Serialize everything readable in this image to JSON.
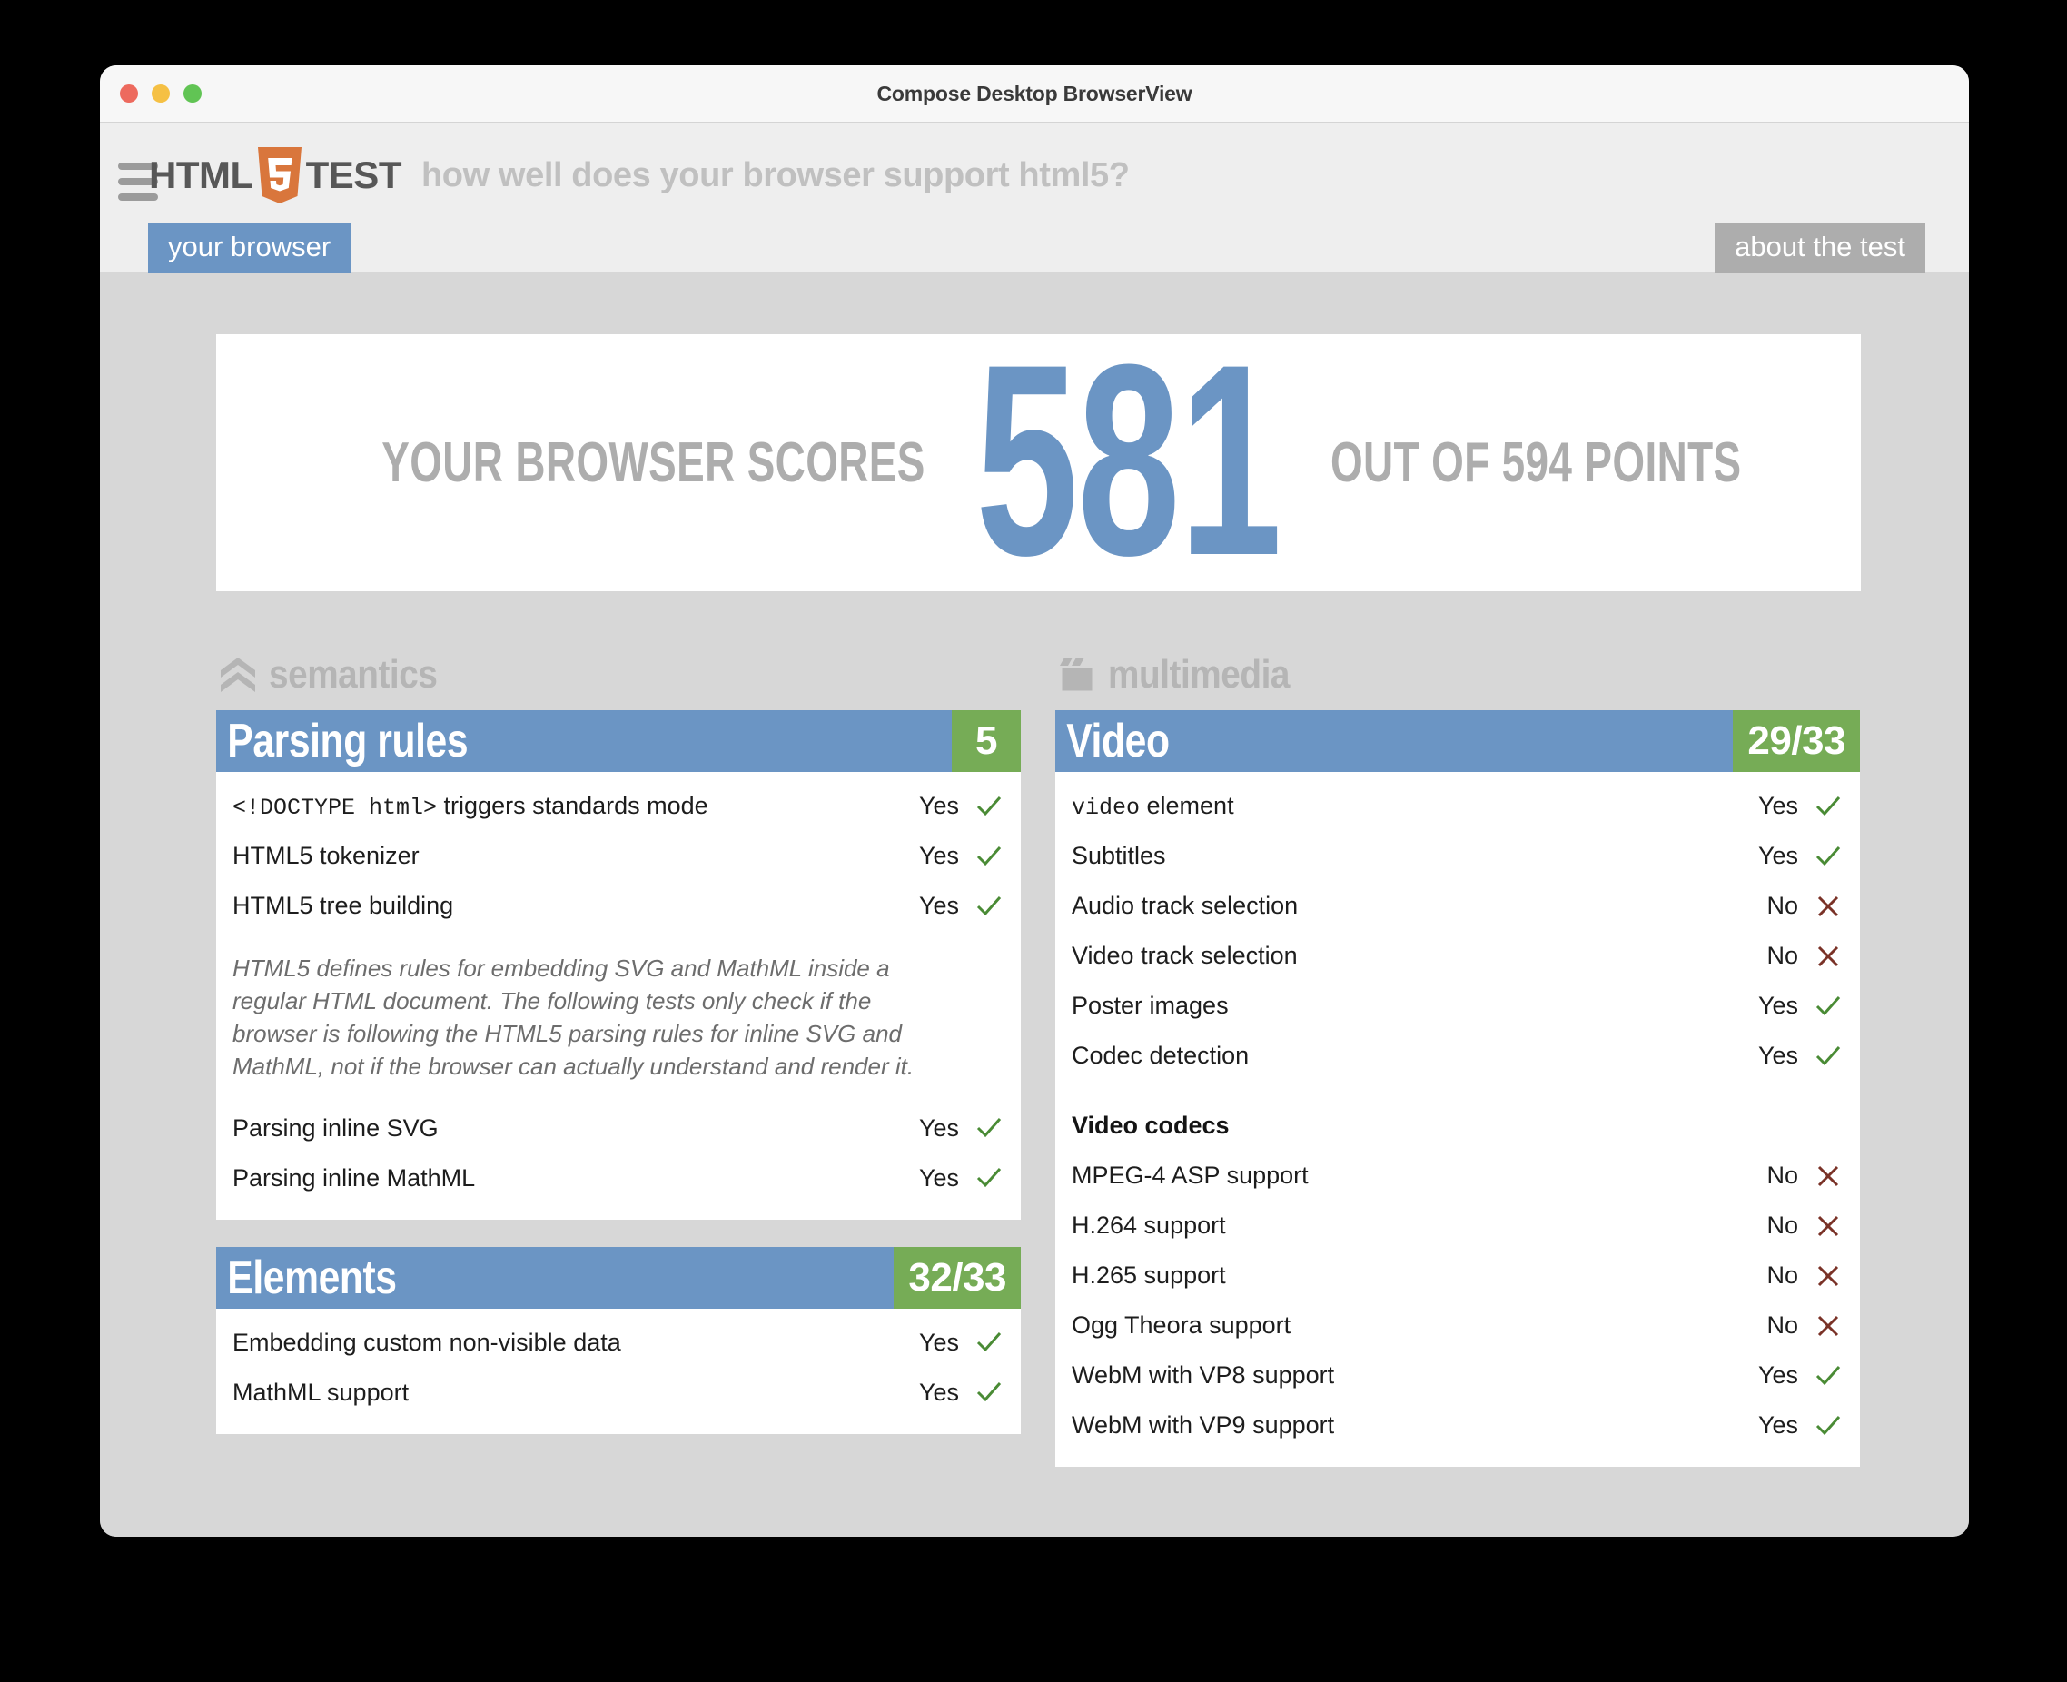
{
  "window": {
    "title": "Compose Desktop BrowserView",
    "traffic_lights": [
      "close-red",
      "minimize-yellow",
      "maximize-green"
    ]
  },
  "site_header": {
    "menu_icon": "hamburger-icon",
    "brand_html": "HTML",
    "brand_shield_digit": "5",
    "brand_test": "TEST",
    "tagline": "how well does your browser support html5?",
    "nav": {
      "your_browser": "your browser",
      "about_the_test": "about the test"
    }
  },
  "score": {
    "prefix": "YOUR BROWSER SCORES",
    "value": "581",
    "suffix": "OUT OF 594 POINTS",
    "points_total": 594,
    "points_scored": 581
  },
  "colors": {
    "accent_blue": "#6b95c4",
    "badge_green": "#76ac56",
    "page_bg": "#d7d7d7",
    "header_bg": "#eeeeee",
    "muted_grey": "#adadad",
    "yes_green": "#4a8b35",
    "no_red": "#7a3227",
    "html5_orange": "#d9763c"
  },
  "categories": [
    {
      "name": "semantics",
      "icon": "chevron-stack-icon",
      "cards": [
        {
          "title": "Parsing rules",
          "score": "5",
          "rows": [
            {
              "type": "test",
              "label": "<!DOCTYPE html> triggers standards mode",
              "code_prefix": "<!DOCTYPE html>",
              "label_rest": " triggers standards mode",
              "verdict": "Yes",
              "mark": "check"
            },
            {
              "type": "test",
              "label": "HTML5 tokenizer",
              "verdict": "Yes",
              "mark": "check"
            },
            {
              "type": "test",
              "label": "HTML5 tree building",
              "verdict": "Yes",
              "mark": "check"
            },
            {
              "type": "note",
              "label": "HTML5 defines rules for embedding SVG and MathML inside a regular HTML document. The following tests only check if the browser is following the HTML5 parsing rules for inline SVG and MathML, not if the browser can actually understand and render it."
            },
            {
              "type": "test",
              "label": "Parsing inline SVG",
              "verdict": "Yes",
              "mark": "check"
            },
            {
              "type": "test",
              "label": "Parsing inline MathML",
              "verdict": "Yes",
              "mark": "check"
            }
          ]
        },
        {
          "title": "Elements",
          "score": "32/33",
          "rows": [
            {
              "type": "test",
              "label": "Embedding custom non-visible data",
              "verdict": "Yes",
              "mark": "check"
            },
            {
              "type": "test",
              "label": "MathML support",
              "verdict": "Yes",
              "mark": "check"
            }
          ]
        }
      ]
    },
    {
      "name": "multimedia",
      "icon": "film-clapper-icon",
      "cards": [
        {
          "title": "Video",
          "score": "29/33",
          "rows": [
            {
              "type": "test",
              "label": "video element",
              "code_prefix": "video",
              "label_rest": " element",
              "verdict": "Yes",
              "mark": "check"
            },
            {
              "type": "test",
              "label": "Subtitles",
              "verdict": "Yes",
              "mark": "check"
            },
            {
              "type": "test",
              "label": "Audio track selection",
              "verdict": "No",
              "mark": "cross"
            },
            {
              "type": "test",
              "label": "Video track selection",
              "verdict": "No",
              "mark": "cross"
            },
            {
              "type": "test",
              "label": "Poster images",
              "verdict": "Yes",
              "mark": "check"
            },
            {
              "type": "test",
              "label": "Codec detection",
              "verdict": "Yes",
              "mark": "check"
            },
            {
              "type": "spacer"
            },
            {
              "type": "subhead",
              "label": "Video codecs"
            },
            {
              "type": "test",
              "label": "MPEG-4 ASP support",
              "verdict": "No",
              "mark": "cross"
            },
            {
              "type": "test",
              "label": "H.264 support",
              "verdict": "No",
              "mark": "cross"
            },
            {
              "type": "test",
              "label": "H.265 support",
              "verdict": "No",
              "mark": "cross"
            },
            {
              "type": "test",
              "label": "Ogg Theora support",
              "verdict": "No",
              "mark": "cross"
            },
            {
              "type": "test",
              "label": "WebM with VP8 support",
              "verdict": "Yes",
              "mark": "check"
            },
            {
              "type": "test",
              "label": "WebM with VP9 support",
              "verdict": "Yes",
              "mark": "check"
            }
          ]
        }
      ]
    }
  ]
}
